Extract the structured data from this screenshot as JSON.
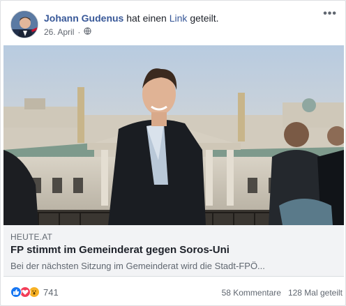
{
  "post": {
    "author": "Johann Gudenus",
    "action_prefix": "hat einen",
    "action_link": "Link",
    "action_suffix": "geteilt.",
    "date": "26. April",
    "privacy_icon": "globe-icon",
    "more_icon": "more-options-icon",
    "more_glyph": "•••"
  },
  "link_preview": {
    "domain": "HEUTE.AT",
    "title": "FP stimmt im Gemeinderat gegen Soros-Uni",
    "description": "Bei der nächsten Sitzung im Gemeinderat wird die Stadt-FPÖ..."
  },
  "reactions": {
    "icons": [
      "like-icon",
      "love-icon",
      "wow-icon"
    ],
    "count": "741",
    "comments": "58 Kommentare",
    "shares": "128 Mal geteilt"
  },
  "colors": {
    "author_link": "#385898",
    "like": "#1877f2",
    "love": "#f33e58",
    "wow": "#f7b125"
  }
}
